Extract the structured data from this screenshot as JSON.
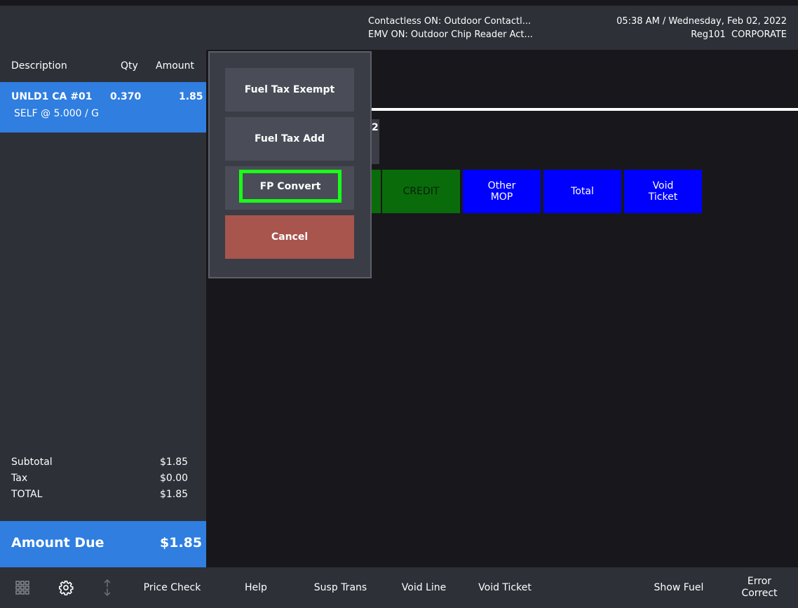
{
  "header": {
    "status_line_1": "Contactless ON: Outdoor Contactl...",
    "status_line_2": "EMV ON: Outdoor Chip Reader Act...",
    "datetime": "05:38 AM / Wednesday, Feb 02, 2022",
    "register": "Reg101  CORPORATE"
  },
  "receipt": {
    "columns": {
      "description": "Description",
      "qty": "Qty",
      "amount": "Amount"
    },
    "items": [
      {
        "description": "UNLD1 CA #01",
        "qty": "0.370",
        "amount": "1.85",
        "detail": "SELF @ 5.000 / G"
      }
    ],
    "subtotal_label": "Subtotal",
    "subtotal_value": "$1.85",
    "tax_label": "Tax",
    "tax_value": "$0.00",
    "total_label": "TOTAL",
    "total_value": "$1.85",
    "amount_due_label": "Amount Due",
    "amount_due_value": "$1.85"
  },
  "main": {
    "peek_tab_text": "2",
    "tiles": [
      {
        "label": "CREDIT"
      },
      {
        "label": "Other\nMOP"
      },
      {
        "label": "Total"
      },
      {
        "label": "Void\nTicket"
      }
    ]
  },
  "popup": {
    "fuel_tax_exempt": "Fuel Tax Exempt",
    "fuel_tax_add": "Fuel Tax Add",
    "fp_convert": "FP Convert",
    "cancel": "Cancel"
  },
  "toolbar": {
    "icons": [
      "grid-icon",
      "gear-icon",
      "sort-arrows-icon"
    ],
    "price_check": "Price Check",
    "help": "Help",
    "susp_trans": "Susp Trans",
    "void_line": "Void Line",
    "void_ticket": "Void Ticket",
    "show_fuel": "Show Fuel",
    "error_correct": "Error\nCorrect"
  },
  "colors": {
    "accent_blue": "#2f7ee0",
    "tile_blue": "#0000ff",
    "credit_green": "#0a6b0a",
    "cancel_red": "#a8554e",
    "focus_green": "#19ff19",
    "panel": "#2d3037",
    "background": "#18181c"
  }
}
